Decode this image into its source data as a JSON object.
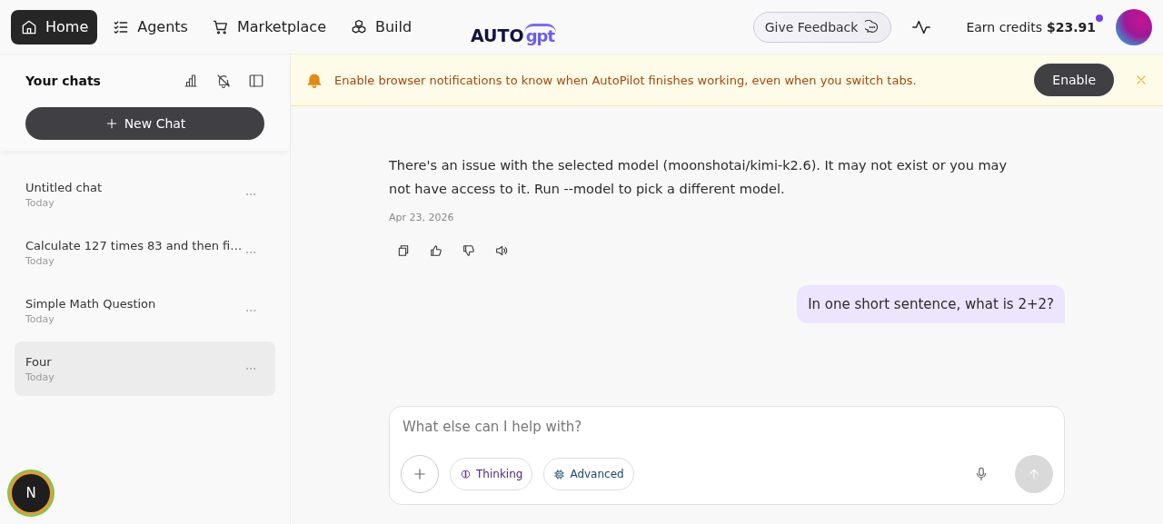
{
  "nav": {
    "items": [
      {
        "label": "Home",
        "kind": "home",
        "selected": true
      },
      {
        "label": "Agents",
        "kind": "agents",
        "selected": false
      },
      {
        "label": "Marketplace",
        "kind": "marketplace",
        "selected": false
      },
      {
        "label": "Build",
        "kind": "build",
        "selected": false
      }
    ],
    "logo": {
      "word": "AUTO",
      "mark": "gpt"
    },
    "feedback_button": "Give Feedback",
    "credits": {
      "label": "Earn credits",
      "amount": "$23.91",
      "unread": true
    }
  },
  "sidebar": {
    "title": "Your chats",
    "new_chat_button": "New Chat",
    "chats": [
      {
        "title": "Untitled chat",
        "date": "Today",
        "selected": false
      },
      {
        "title": "Calculate 127 times 83 and then fi…",
        "date": "Today",
        "selected": false
      },
      {
        "title": "Simple Math Question",
        "date": "Today",
        "selected": false
      },
      {
        "title": "Four",
        "date": "Today",
        "selected": true
      }
    ],
    "badge": "N"
  },
  "banner": {
    "text": "Enable browser notifications to know when AutoPilot finishes working, even when you switch tabs.",
    "button": "Enable"
  },
  "messages": [
    {
      "kind": "assistant",
      "text": "There's an issue with the selected model (moonshotai/kimi-k2.6). It may not exist or you may not have access to it. Run --model to pick a different model.",
      "date": "Apr 23, 2026"
    },
    {
      "kind": "user",
      "text": "In one short sentence, what is 2+2?"
    }
  ],
  "composer": {
    "placeholder": "What else can I help with?",
    "chips": [
      {
        "label": "Thinking",
        "kind": "thinking"
      },
      {
        "label": "Advanced",
        "kind": "advanced"
      }
    ]
  }
}
